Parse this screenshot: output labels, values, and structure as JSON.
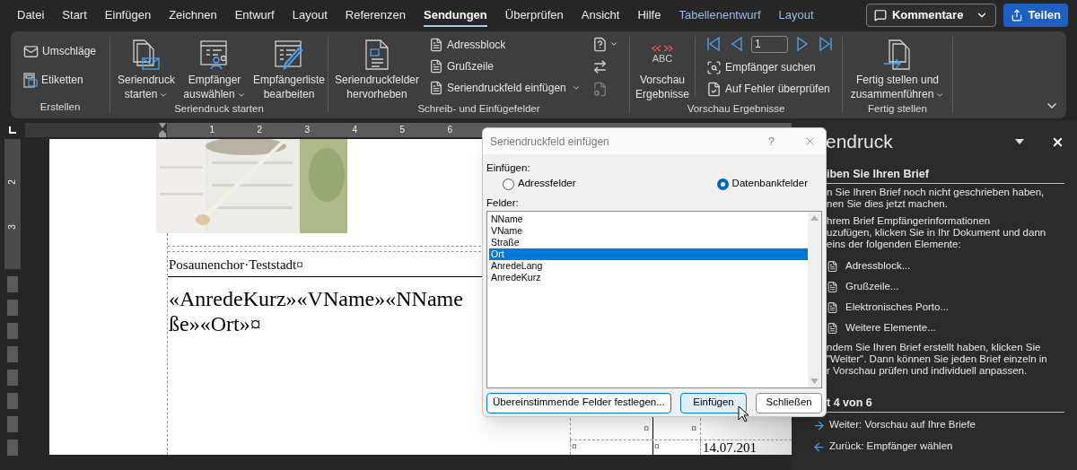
{
  "menu_tabs": [
    {
      "label": "Datei",
      "selected": false,
      "kind": "standard"
    },
    {
      "label": "Start",
      "selected": false,
      "kind": "standard"
    },
    {
      "label": "Einfügen",
      "selected": false,
      "kind": "standard"
    },
    {
      "label": "Zeichnen",
      "selected": false,
      "kind": "standard"
    },
    {
      "label": "Entwurf",
      "selected": false,
      "kind": "standard"
    },
    {
      "label": "Layout",
      "selected": false,
      "kind": "standard"
    },
    {
      "label": "Referenzen",
      "selected": false,
      "kind": "standard"
    },
    {
      "label": "Sendungen",
      "selected": true,
      "kind": "standard"
    },
    {
      "label": "Überprüfen",
      "selected": false,
      "kind": "standard"
    },
    {
      "label": "Ansicht",
      "selected": false,
      "kind": "standard"
    },
    {
      "label": "Hilfe",
      "selected": false,
      "kind": "standard"
    },
    {
      "label": "Tabellenentwurf",
      "selected": false,
      "kind": "contextual"
    },
    {
      "label": "Layout",
      "selected": false,
      "kind": "contextual"
    }
  ],
  "comments_button": {
    "label": "Kommentare"
  },
  "share_button": {
    "label": "Teilen"
  },
  "ribbon_groups": [
    {
      "title": "Erstellen",
      "buttons": [
        {
          "lines": [
            "Umschläge"
          ],
          "dropdown": false
        },
        {
          "lines": [
            "Etiketten"
          ],
          "dropdown": false
        }
      ]
    },
    {
      "title": "Seriendruck starten",
      "buttons": [
        {
          "lines": [
            "Seriendruck",
            "starten"
          ],
          "dropdown": true
        },
        {
          "lines": [
            "Empfänger",
            "auswählen"
          ],
          "dropdown": true
        },
        {
          "lines": [
            "Empfängerliste",
            "bearbeiten"
          ],
          "dropdown": false
        }
      ]
    },
    {
      "title": "Schreib- und Einfügefelder",
      "buttons": [
        {
          "lines": [
            "Seriendruckfelder",
            "hervorheben"
          ],
          "dropdown": false
        },
        {
          "lines": [
            "Adressblock"
          ],
          "dropdown": false
        },
        {
          "lines": [
            "Grußzeile"
          ],
          "dropdown": false
        },
        {
          "lines": [
            "Seriendruckfeld einfügen"
          ],
          "dropdown": true
        }
      ],
      "icon_buttons": [
        {
          "dropdown": true,
          "disabled": false
        },
        {
          "dropdown": false,
          "disabled": false
        },
        {
          "dropdown": false,
          "disabled": true
        }
      ]
    },
    {
      "title": "Vorschau Ergebnisse",
      "buttons": [
        {
          "lines": [
            "Vorschau",
            "Ergebnisse"
          ],
          "dropdown": false,
          "icon_text": "ABC"
        },
        {
          "lines": [
            "Empfänger suchen"
          ],
          "dropdown": false
        },
        {
          "lines": [
            "Auf Fehler überprüfen"
          ],
          "dropdown": false
        }
      ],
      "record_field": {
        "value": "1"
      }
    },
    {
      "title": "Fertig stellen",
      "buttons": [
        {
          "lines": [
            "Fertig stellen und",
            "zusammenführen"
          ],
          "dropdown": true
        }
      ]
    }
  ],
  "ruler": {
    "numbers": [
      "1",
      "2",
      "3",
      "4",
      "5",
      "6"
    ]
  },
  "vertical_ruler": {
    "numbers": [
      "2",
      "3"
    ]
  },
  "document": {
    "header": "Posaunenchor·Teststadt¤",
    "merge_lines": [
      "«AnredeKurz»«VName»«NName",
      "ße»«Ort»¤"
    ],
    "table_rows": [
      [
        "¤",
        "¤"
      ],
      [
        "¤",
        "¤",
        "14.07.201"
      ]
    ]
  },
  "dialog": {
    "title": "Seriendruckfeld einfügen",
    "help": "?",
    "insert_label": "Einfügen:",
    "options": [
      {
        "label": "Adressfelder",
        "selected": false
      },
      {
        "label": "Datenbankfelder",
        "selected": true
      }
    ],
    "fields_label": "Felder:",
    "fields": [
      {
        "label": "NName",
        "selected": false
      },
      {
        "label": "VName",
        "selected": false
      },
      {
        "label": "Straße",
        "selected": false
      },
      {
        "label": "Ort",
        "selected": true
      },
      {
        "label": "AnredeLang",
        "selected": false
      },
      {
        "label": "AnredeKurz",
        "selected": false
      }
    ],
    "buttons": [
      {
        "label": "Übereinstimmende Felder festlegen...",
        "focused": false
      },
      {
        "label": "Einfügen",
        "focused": true
      },
      {
        "label": "Schließen",
        "focused": false
      }
    ]
  },
  "task_pane": {
    "title": "endruck",
    "heading": "iben Sie Ihren Brief",
    "paragraphs": [
      [
        "n Sie Ihren Brief noch nicht geschrieben haben,",
        "nen Sie dies jetzt machen."
      ],
      [
        "hrem Brief Empfängerinformationen",
        "uzufügen, klicken Sie in Ihr Dokument und dann",
        "eins der folgenden Elemente:"
      ]
    ],
    "links": [
      "Adressblock...",
      "Grußzeile...",
      "Elektronisches Porto...",
      "Weitere Elemente..."
    ],
    "note": [
      "ndem Sie Ihren Brief erstellt haben, klicken Sie",
      "\"Weiter\". Dann können Sie jeden Brief einzeln in",
      "r Vorschau prüfen und individuell anpassen."
    ],
    "step": "t 4 von 6",
    "nav": [
      {
        "label": "Weiter: Vorschau auf Ihre Briefe",
        "kind": "next"
      },
      {
        "label": "Zurück: Empfänger wählen",
        "kind": "back"
      }
    ]
  }
}
